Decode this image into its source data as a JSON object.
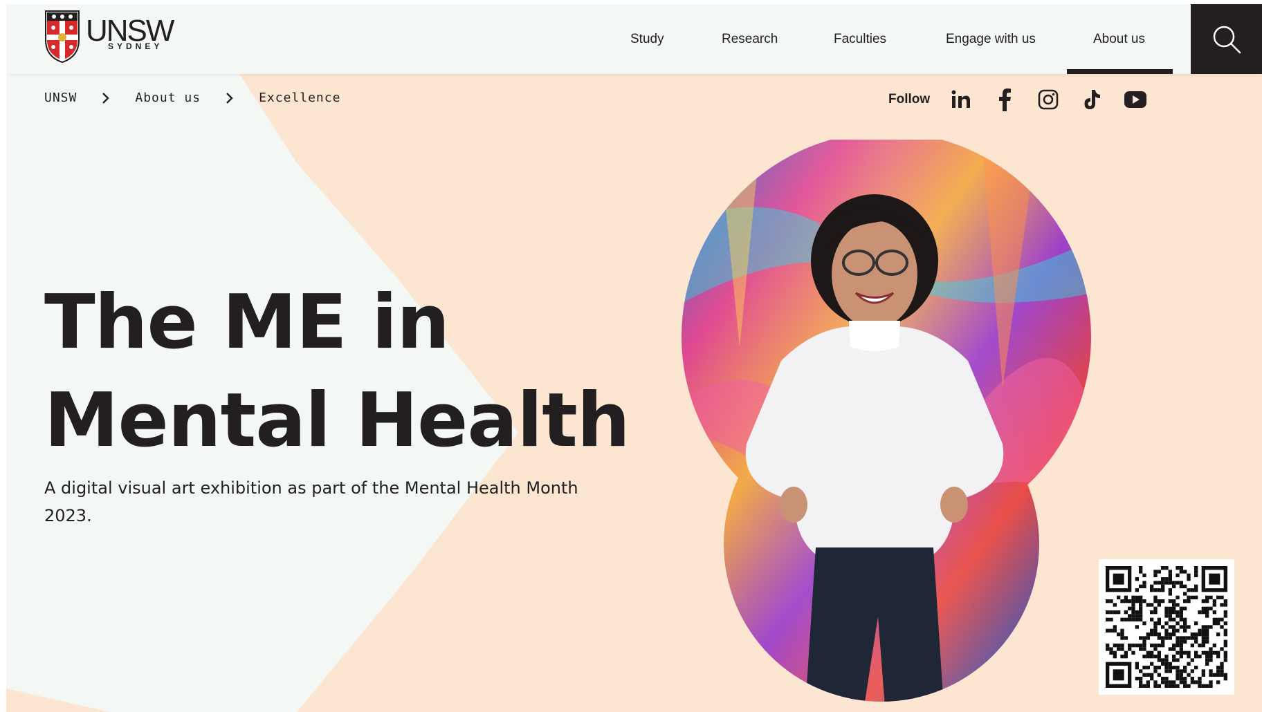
{
  "header": {
    "logo": {
      "wordmark": "UNSW",
      "wordmark_sub": "SYDNEY"
    },
    "nav": [
      {
        "label": "Study"
      },
      {
        "label": "Research"
      },
      {
        "label": "Faculties"
      },
      {
        "label": "Engage with us"
      },
      {
        "label": "About us",
        "active": true
      }
    ],
    "search_icon": "search-icon"
  },
  "breadcrumb": {
    "items": [
      "UNSW",
      "About us",
      "Excellence"
    ],
    "separator_icon": "chevron-right-icon"
  },
  "social": {
    "follow_label": "Follow",
    "icons": [
      "linkedin-icon",
      "facebook-icon",
      "instagram-icon",
      "tiktok-icon",
      "youtube-icon"
    ]
  },
  "hero": {
    "title_line1": "The ME in",
    "title_line2": "Mental Health",
    "subtitle": "A digital visual art exhibition as part of the Mental Health Month 2023.",
    "image": "woman-smiling-in-front-of-graffiti-wall"
  },
  "colors": {
    "peach": "#fce6d2",
    "mint": "#f3f8f5",
    "ink": "#231f20",
    "crest_red": "#d62a2a"
  }
}
